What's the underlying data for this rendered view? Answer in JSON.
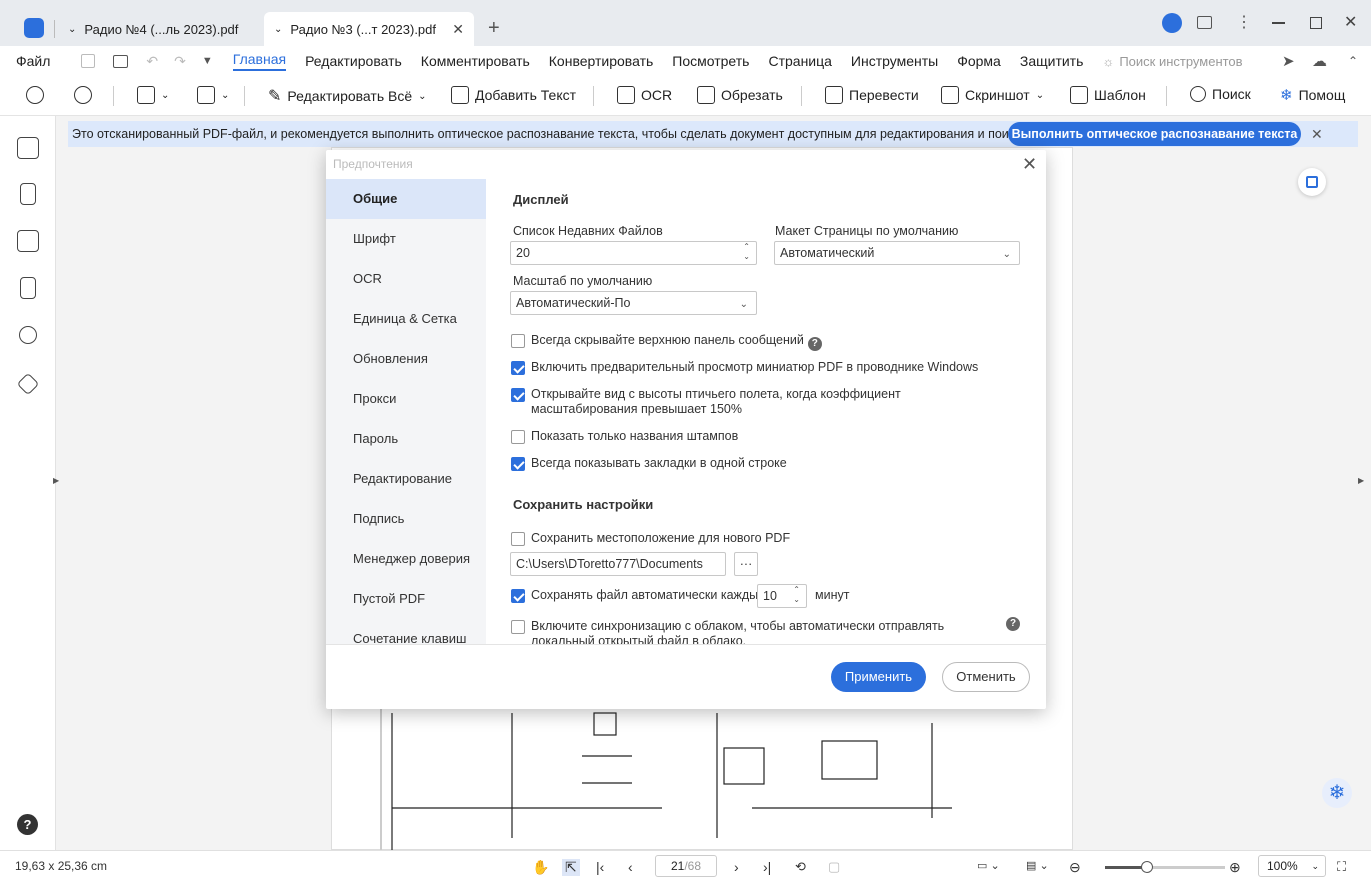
{
  "titlebar": {
    "tabs": [
      {
        "label": "Радио №4 (...ль 2023).pdf"
      },
      {
        "label": "Радио №3 (...т 2023).pdf"
      }
    ],
    "new_tab": "+"
  },
  "menubar": {
    "file": "Файл",
    "items": [
      "Главная",
      "Редактировать",
      "Комментировать",
      "Конвертировать",
      "Посмотреть",
      "Страница",
      "Инструменты",
      "Форма",
      "Защитить"
    ],
    "tool_search": "Поиск инструментов"
  },
  "toolbar": {
    "edit_all": "Редактировать Всё",
    "add_text": "Добавить Текст",
    "ocr": "OCR",
    "crop": "Обрезать",
    "translate": "Перевести",
    "screenshot": "Скриншот",
    "template": "Шаблон",
    "search": "Поиск",
    "help": "Помощ"
  },
  "banner": {
    "text": "Это отсканированный PDF-файл, и рекомендуется выполнить оптическое распознавание текста, чтобы сделать документ доступным для редактирования и поиска.",
    "button": "Выполнить оптическое распознавание текста"
  },
  "dialog": {
    "title": "Предпочтения",
    "nav": [
      "Общие",
      "Шрифт",
      "OCR",
      "Единица & Сетка",
      "Обновления",
      "Прокси",
      "Пароль",
      "Редактирование",
      "Подпись",
      "Менеджер доверия",
      "Пустой PDF",
      "Сочетание клавиш"
    ],
    "display": {
      "title": "Дисплей",
      "recent_label": "Список Недавних Файлов",
      "recent_value": "20",
      "layout_label": "Макет Страницы по умолчанию",
      "layout_value": "Автоматический",
      "zoom_label": "Масштаб по умолчанию",
      "zoom_value": "Автоматический-По",
      "options": [
        {
          "label": "Всегда скрывайте верхнюю панель сообщений",
          "checked": false
        },
        {
          "label": "Включить предварительный просмотр миниатюр PDF в проводнике Windows",
          "checked": true
        },
        {
          "label": "Открывайте вид с высоты птичьего полета, когда коэффициент масштабирования превышает 150%",
          "checked": true
        },
        {
          "label": "Показать только названия штампов",
          "checked": false
        },
        {
          "label": "Всегда показывать закладки в одной строке",
          "checked": true
        }
      ]
    },
    "save": {
      "title": "Сохранить настройки",
      "save_location_label": "Сохранить местоположение для нового PDF",
      "path_value": "C:\\Users\\DToretto777\\Documents",
      "browse": "···",
      "autosave_label": "Сохранять файл автоматически каждые",
      "autosave_value": "10",
      "minutes": "минут",
      "cloud_label": "Включите синхронизацию с облаком, чтобы автоматически отправлять локальный открытый файл в облако."
    },
    "apply": "Применить",
    "cancel": "Отменить"
  },
  "statusbar": {
    "size": "19,63 x 25,36 cm",
    "page_current": "21",
    "page_total": "/68",
    "zoom": "100%"
  }
}
